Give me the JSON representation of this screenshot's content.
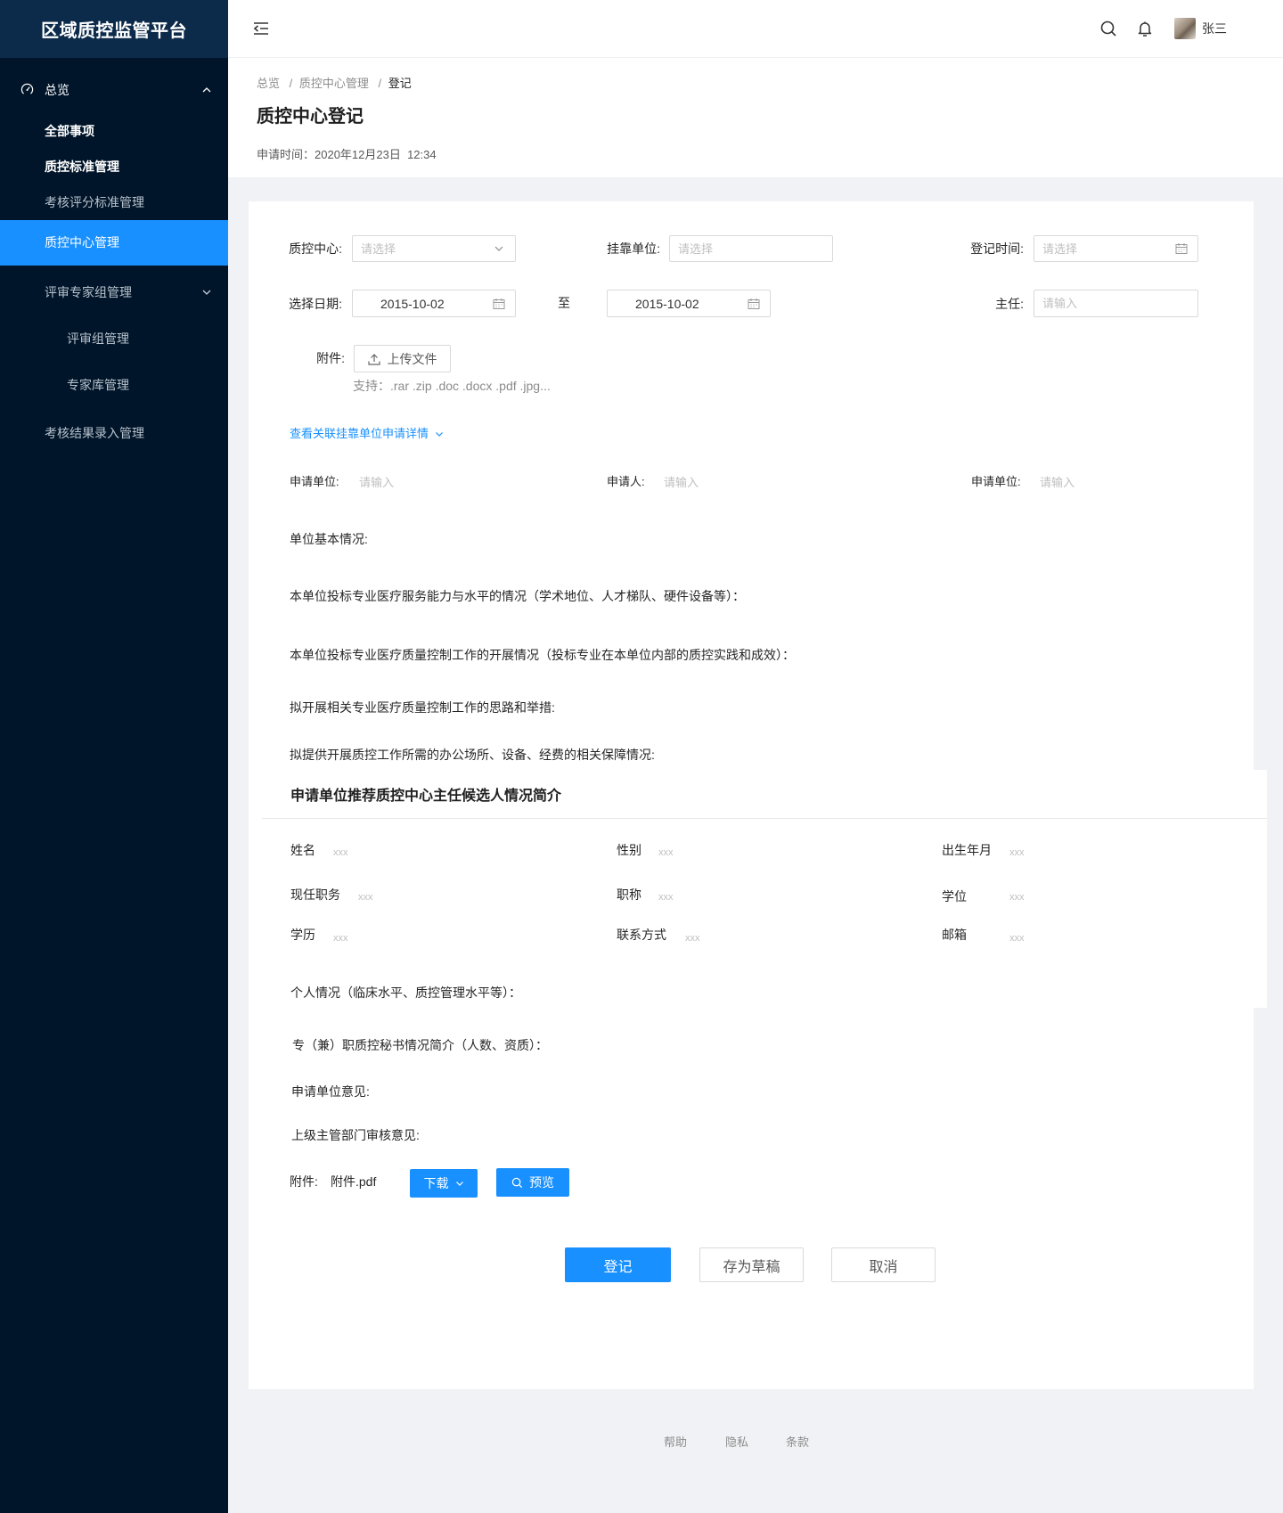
{
  "app": {
    "title": "区域质控监管平台"
  },
  "sidebar": {
    "items": [
      {
        "label": "总览",
        "icon": "dashboard-icon"
      },
      {
        "label": "全部事项"
      },
      {
        "label": "质控标准管理"
      },
      {
        "label": "考核评分标准管理"
      },
      {
        "label": "质控中心管理",
        "active": true
      },
      {
        "label": "评审专家组管理"
      },
      {
        "label": "评审组管理"
      },
      {
        "label": "专家库管理"
      },
      {
        "label": "考核结果录入管理"
      }
    ]
  },
  "header": {
    "icons": [
      "menu-fold-icon",
      "search-icon",
      "bell-icon"
    ],
    "user_name": "张三"
  },
  "breadcrumb": {
    "items": [
      "总览",
      "质控中心管理",
      "登记"
    ],
    "separator": "/"
  },
  "page": {
    "title": "质控中心登记",
    "apply_time": "申请时间：2020年12月23日  12:34"
  },
  "form": {
    "quality_center": {
      "label": "质控中心:",
      "placeholder": "请选择"
    },
    "affiliated_unit": {
      "label": "挂靠单位:",
      "placeholder": "请选择"
    },
    "register_time": {
      "label": "登记时间:",
      "placeholder": "请选择"
    },
    "date_range": {
      "label": "选择日期:",
      "start": "2015-10-02",
      "to": "至",
      "end": "2015-10-02"
    },
    "director": {
      "label": "主任:",
      "placeholder": "请输入"
    },
    "attachment": {
      "label": "附件:",
      "upload_button": "上传文件",
      "hint": "支持：.rar .zip .doc .docx .pdf .jpg..."
    },
    "related_link": "查看关联挂靠单位申请详情",
    "applicant_fields": [
      {
        "label": "申请单位:",
        "placeholder": "请输入"
      },
      {
        "label": "申请人:",
        "placeholder": "请输入"
      },
      {
        "label": "申请单位:",
        "placeholder": "请输入"
      }
    ],
    "unit_sections": [
      "单位基本情况:",
      "本单位投标专业医疗服务能力与水平的情况（学术地位、人才梯队、硬件设备等）：",
      "本单位投标专业医疗质量控制工作的开展情况（投标专业在本单位内部的质控实践和成效）：",
      "拟开展相关专业医疗质量控制工作的思路和举措:",
      "拟提供开展质控工作所需的办公场所、设备、经费的相关保障情况:"
    ]
  },
  "candidate": {
    "title": "申请单位推荐质控中心主任候选人情况简介",
    "fields": [
      {
        "label": "姓名",
        "value": "xxx"
      },
      {
        "label": "性别",
        "value": "xxx"
      },
      {
        "label": "出生年月",
        "value": "xxx"
      },
      {
        "label": "现任职务",
        "value": "xxx"
      },
      {
        "label": "职称",
        "value": "xxx"
      },
      {
        "label": "学位",
        "value": "xxx"
      },
      {
        "label": "学历",
        "value": "xxx"
      },
      {
        "label": "联系方式",
        "value": "xxx"
      },
      {
        "label": "邮箱",
        "value": "xxx"
      }
    ],
    "personal": "个人情况（临床水平、质控管理水平等）："
  },
  "secretary": "专（兼）职质控秘书情况简介（人数、资质）：",
  "opinions": [
    "申请单位意见:",
    "上级主管部门审核意见:"
  ],
  "file": {
    "label": "附件:",
    "name": "附件.pdf",
    "download_button": "下载",
    "preview_button": "预览"
  },
  "actions": {
    "register": "登记",
    "save_draft": "存为草稿",
    "cancel": "取消"
  },
  "footer": {
    "links": [
      "帮助",
      "隐私",
      "条款"
    ]
  },
  "colors": {
    "sidebar_bg": "#001529",
    "sidebar_logo_bg": "#0c2a4a",
    "primary": "#1890ff",
    "page_bg": "#f0f2f5"
  }
}
